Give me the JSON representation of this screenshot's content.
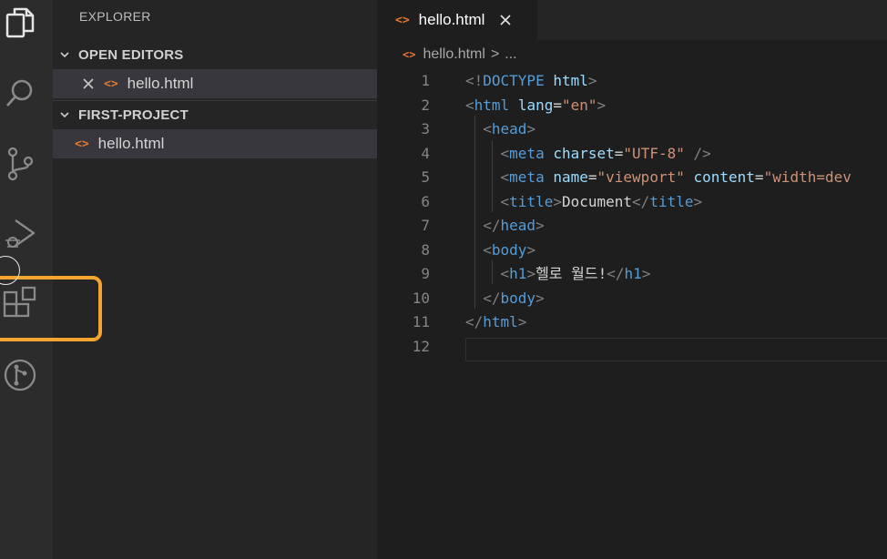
{
  "sidebar": {
    "title": "EXPLORER",
    "open_editors": {
      "label": "OPEN EDITORS",
      "files": [
        {
          "name": "hello.html"
        }
      ]
    },
    "project": {
      "label": "FIRST-PROJECT",
      "files": [
        {
          "name": "hello.html"
        }
      ]
    }
  },
  "tab": {
    "label": "hello.html"
  },
  "breadcrumb": {
    "file": "hello.html",
    "separator": ">",
    "trail": "..."
  },
  "editor": {
    "line_numbers": [
      "1",
      "2",
      "3",
      "4",
      "5",
      "6",
      "7",
      "8",
      "9",
      "10",
      "11",
      "12"
    ],
    "lines": [
      {
        "tokens": [
          {
            "t": "punc",
            "v": "<!"
          },
          {
            "t": "tag",
            "v": "DOCTYPE"
          },
          {
            "t": "text",
            "v": " "
          },
          {
            "t": "attr",
            "v": "html"
          },
          {
            "t": "punc",
            "v": ">"
          }
        ]
      },
      {
        "tokens": [
          {
            "t": "punc",
            "v": "<"
          },
          {
            "t": "tag",
            "v": "html"
          },
          {
            "t": "text",
            "v": " "
          },
          {
            "t": "attr",
            "v": "lang"
          },
          {
            "t": "text",
            "v": "="
          },
          {
            "t": "str",
            "v": "\"en\""
          },
          {
            "t": "punc",
            "v": ">"
          }
        ]
      },
      {
        "tokens": [
          {
            "t": "text",
            "v": "  "
          },
          {
            "t": "punc",
            "v": "<"
          },
          {
            "t": "tag",
            "v": "head"
          },
          {
            "t": "punc",
            "v": ">"
          }
        ]
      },
      {
        "tokens": [
          {
            "t": "text",
            "v": "    "
          },
          {
            "t": "punc",
            "v": "<"
          },
          {
            "t": "tag",
            "v": "meta"
          },
          {
            "t": "text",
            "v": " "
          },
          {
            "t": "attr",
            "v": "charset"
          },
          {
            "t": "text",
            "v": "="
          },
          {
            "t": "str",
            "v": "\"UTF-8\""
          },
          {
            "t": "text",
            "v": " "
          },
          {
            "t": "punc",
            "v": "/>"
          }
        ]
      },
      {
        "tokens": [
          {
            "t": "text",
            "v": "    "
          },
          {
            "t": "punc",
            "v": "<"
          },
          {
            "t": "tag",
            "v": "meta"
          },
          {
            "t": "text",
            "v": " "
          },
          {
            "t": "attr",
            "v": "name"
          },
          {
            "t": "text",
            "v": "="
          },
          {
            "t": "str",
            "v": "\"viewport\""
          },
          {
            "t": "text",
            "v": " "
          },
          {
            "t": "attr",
            "v": "content"
          },
          {
            "t": "text",
            "v": "="
          },
          {
            "t": "str",
            "v": "\"width=dev"
          }
        ]
      },
      {
        "tokens": [
          {
            "t": "text",
            "v": "    "
          },
          {
            "t": "punc",
            "v": "<"
          },
          {
            "t": "tag",
            "v": "title"
          },
          {
            "t": "punc",
            "v": ">"
          },
          {
            "t": "text",
            "v": "Document"
          },
          {
            "t": "punc",
            "v": "</"
          },
          {
            "t": "tag",
            "v": "title"
          },
          {
            "t": "punc",
            "v": ">"
          }
        ]
      },
      {
        "tokens": [
          {
            "t": "text",
            "v": "  "
          },
          {
            "t": "punc",
            "v": "</"
          },
          {
            "t": "tag",
            "v": "head"
          },
          {
            "t": "punc",
            "v": ">"
          }
        ]
      },
      {
        "tokens": [
          {
            "t": "text",
            "v": "  "
          },
          {
            "t": "punc",
            "v": "<"
          },
          {
            "t": "tag",
            "v": "body"
          },
          {
            "t": "punc",
            "v": ">"
          }
        ]
      },
      {
        "tokens": [
          {
            "t": "text",
            "v": "    "
          },
          {
            "t": "punc",
            "v": "<"
          },
          {
            "t": "tag",
            "v": "h1"
          },
          {
            "t": "punc",
            "v": ">"
          },
          {
            "t": "text",
            "v": "헬로 월드!"
          },
          {
            "t": "punc",
            "v": "</"
          },
          {
            "t": "tag",
            "v": "h1"
          },
          {
            "t": "punc",
            "v": ">"
          }
        ]
      },
      {
        "tokens": [
          {
            "t": "text",
            "v": "  "
          },
          {
            "t": "punc",
            "v": "</"
          },
          {
            "t": "tag",
            "v": "body"
          },
          {
            "t": "punc",
            "v": ">"
          }
        ]
      },
      {
        "tokens": [
          {
            "t": "punc",
            "v": "</"
          },
          {
            "t": "tag",
            "v": "html"
          },
          {
            "t": "punc",
            "v": ">"
          }
        ]
      },
      {
        "tokens": []
      }
    ]
  },
  "colors": {
    "highlight_box": "#f3a530",
    "html_icon": "#e37933",
    "tag": "#569cd6",
    "attribute": "#9cdcfe",
    "string": "#ce9178"
  }
}
